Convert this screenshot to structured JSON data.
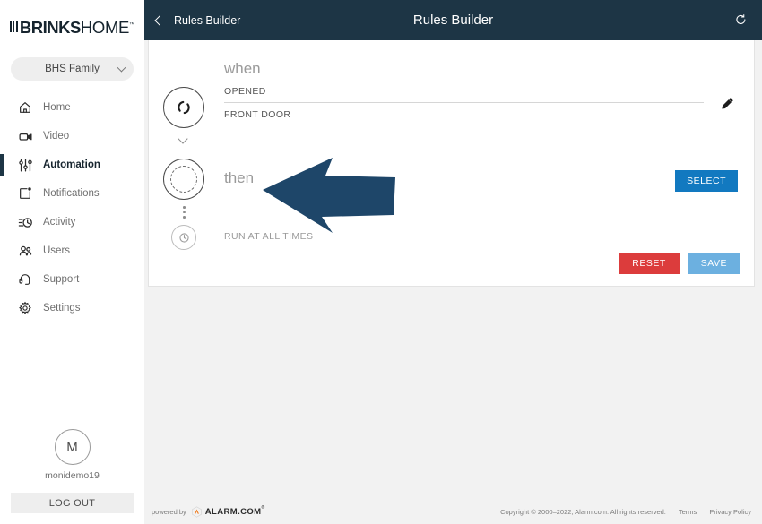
{
  "brand": {
    "logo_bold": "BRINKS",
    "logo_light": "HOME",
    "trademark": "™"
  },
  "sidebar": {
    "family_selector": {
      "label": "BHS Family",
      "icon": "chevron-down-icon"
    },
    "items": [
      {
        "label": "Home",
        "icon": "home-icon",
        "active": false
      },
      {
        "label": "Video",
        "icon": "video-camera-icon",
        "active": false
      },
      {
        "label": "Automation",
        "icon": "sliders-icon",
        "active": true
      },
      {
        "label": "Notifications",
        "icon": "notification-square-icon",
        "active": false
      },
      {
        "label": "Activity",
        "icon": "activity-clock-icon",
        "active": false
      },
      {
        "label": "Users",
        "icon": "users-icon",
        "active": false
      },
      {
        "label": "Support",
        "icon": "headset-icon",
        "active": false
      },
      {
        "label": "Settings",
        "icon": "gear-icon",
        "active": false
      }
    ],
    "user": {
      "avatar_initial": "M",
      "username": "monidemo19",
      "logout_label": "LOG OUT"
    }
  },
  "header": {
    "back_label": "Rules Builder",
    "title": "Rules Builder",
    "back_icon": "chevron-left-icon",
    "refresh_icon": "refresh-icon"
  },
  "rule": {
    "when_label": "when",
    "when_icon": "broken-ring-icon",
    "trigger_state": "OPENED",
    "trigger_device": "FRONT DOOR",
    "edit_icon": "pencil-icon",
    "expand_icon": "chevron-down-icon",
    "then_label": "then",
    "then_icon": "dashed-circle-icon",
    "then_select_label": "SELECT",
    "schedule_icon": "clock-icon",
    "schedule_label": "RUN AT ALL TIMES",
    "reset_label": "RESET",
    "save_label": "SAVE"
  },
  "annotation": {
    "arrow": "left-pointing-arrow",
    "color": "#1e4669"
  },
  "footer": {
    "powered_by": "powered by",
    "partner_logo_text": "ALARM.COM",
    "partner_logo_tm": "®",
    "copyright": "Copyright © 2000–2022, Alarm.com. All rights reserved.",
    "terms": "Terms",
    "privacy": "Privacy Policy"
  },
  "colors": {
    "header_bg": "#1d3545",
    "select_blue": "#1279c0",
    "reset_red": "#dc3c3c",
    "save_blue": "#6cb0e0",
    "accent_orange": "#f07d22"
  }
}
